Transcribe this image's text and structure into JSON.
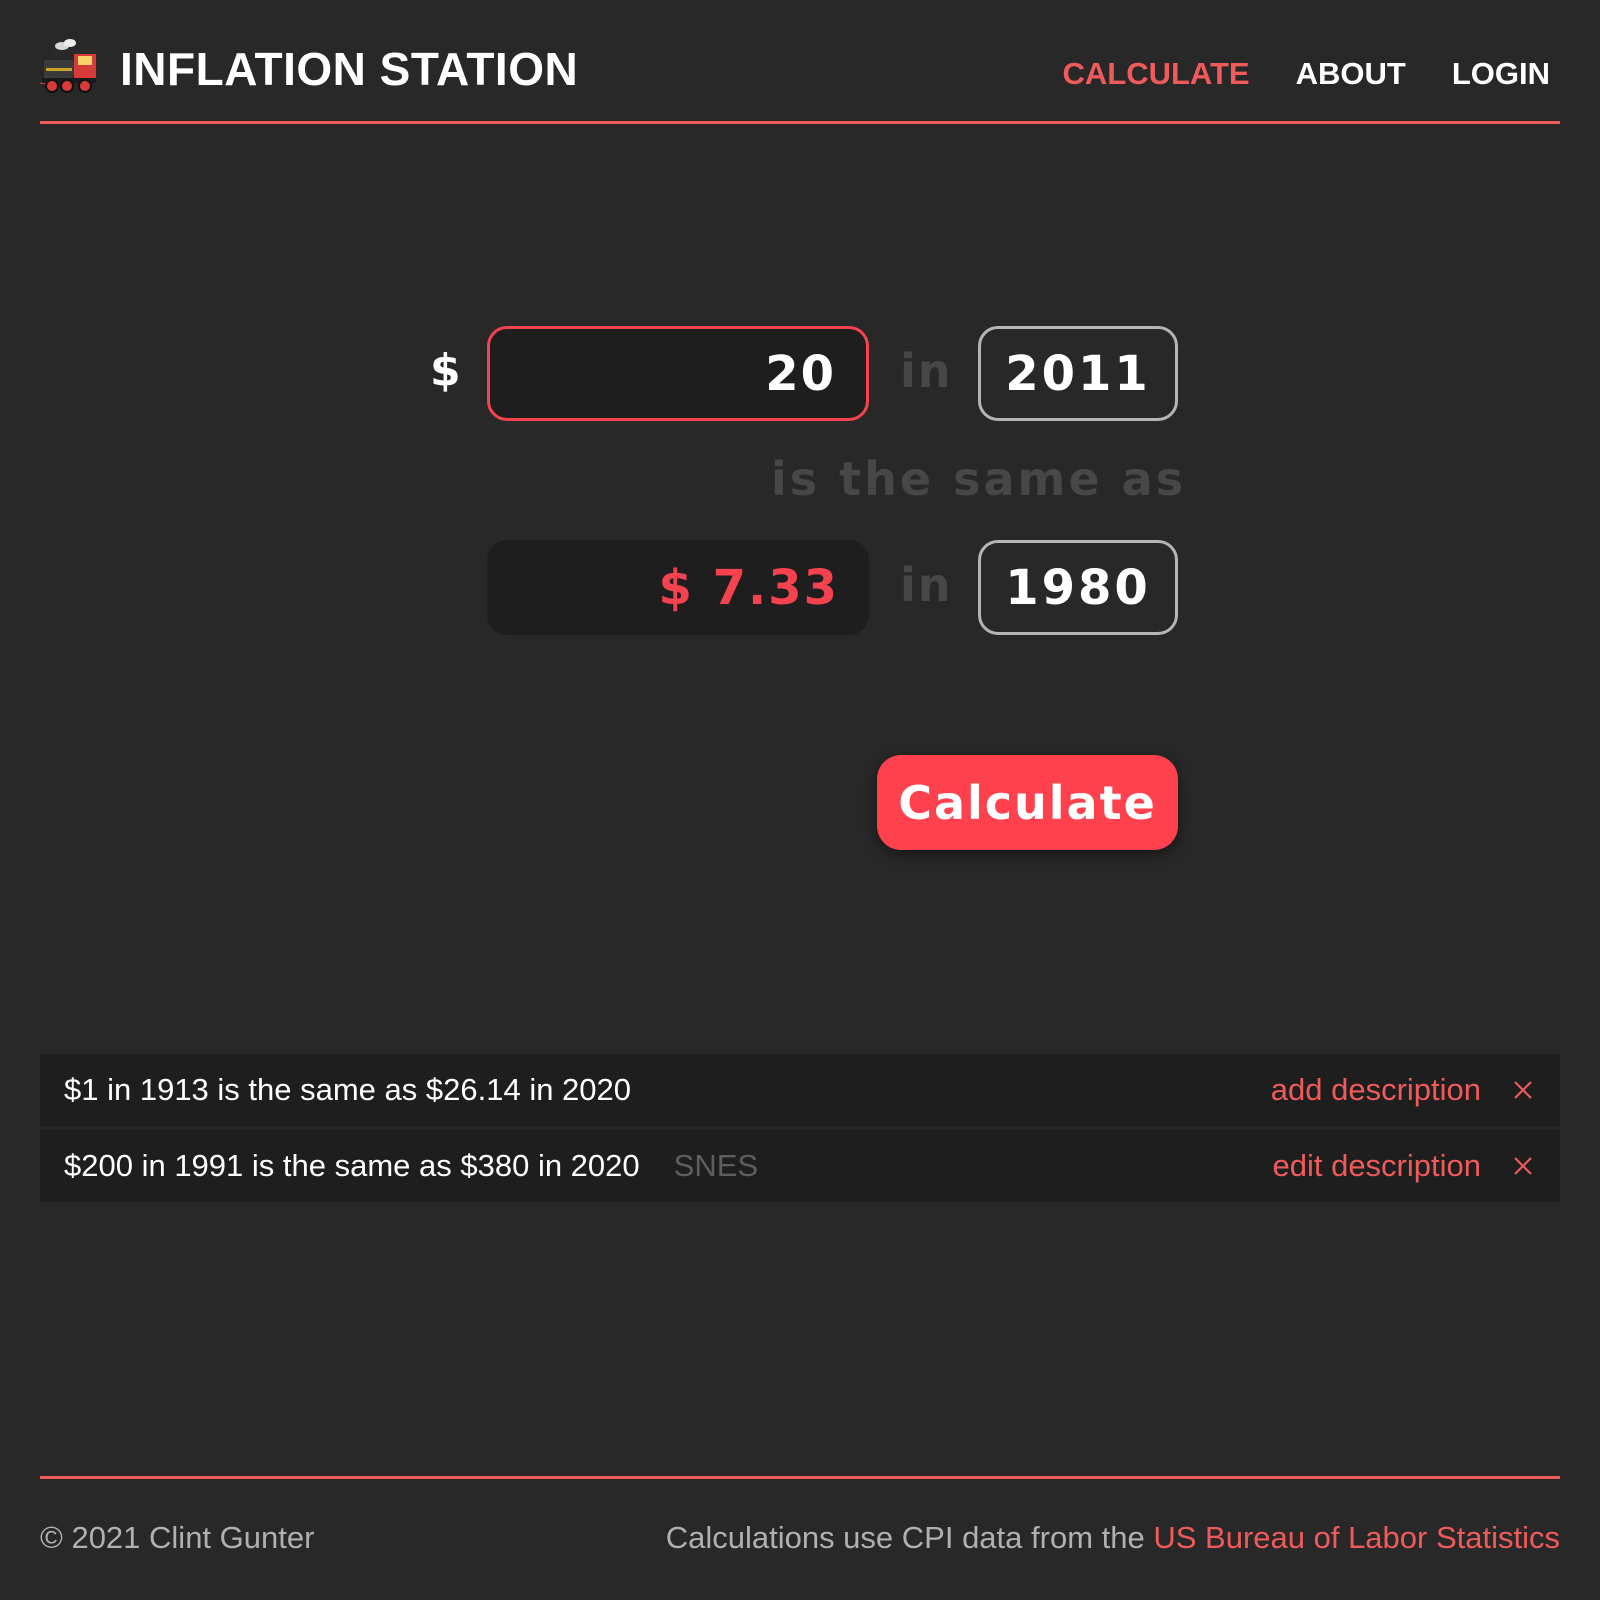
{
  "header": {
    "logo_icon": "locomotive-icon",
    "brand": "INFLATION STATION",
    "nav": [
      {
        "label": "CALCULATE",
        "active": true
      },
      {
        "label": "ABOUT",
        "active": false
      },
      {
        "label": "LOGIN",
        "active": false
      }
    ]
  },
  "calculator": {
    "currency_symbol": "$",
    "amount": "20",
    "in_label": "in",
    "from_year": "2011",
    "same_as_label": "is the same as",
    "result": "$ 7.33",
    "to_year": "1980",
    "button_label": "Calculate"
  },
  "history": [
    {
      "text": "$1 in 1913 is the same as $26.14 in 2020",
      "description": "",
      "action": "add description",
      "close_icon": "close-icon"
    },
    {
      "text": "$200 in 1991 is the same as $380 in 2020",
      "description": "SNES",
      "action": "edit description",
      "close_icon": "close-icon"
    }
  ],
  "footer": {
    "copyright": "© 2021 Clint Gunter",
    "credit_text": "Calculations use CPI data from the ",
    "credit_link": "US Bureau of Labor Statistics"
  },
  "colors": {
    "background": "#282828",
    "accent": "#f05a5a",
    "button": "#fe414d",
    "field_background": "#1e1e1e",
    "muted_text": "#474747"
  }
}
